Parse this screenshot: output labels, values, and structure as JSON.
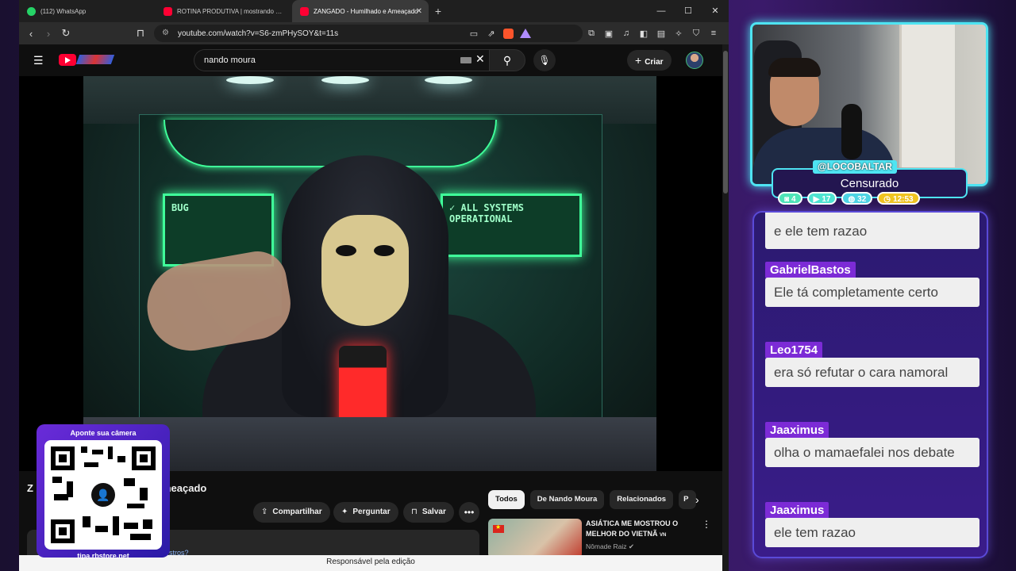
{
  "browser": {
    "tabs": [
      {
        "label": "(112) WhatsApp",
        "icon": "whatsapp-icon"
      },
      {
        "label": "ROTINA PRODUTIVA | mostrando meus hábitos",
        "icon": "youtube-icon"
      },
      {
        "label": "ZANGADO - Humilhado e Ameaçado",
        "icon": "youtube-icon",
        "active": true
      }
    ],
    "url": "youtube.com/watch?v=S6-zmPHySOY&t=11s",
    "status_bar": "Responsável pela edição"
  },
  "youtube": {
    "search_query": "nando moura",
    "create_label": "Criar",
    "video": {
      "title_prefix": "Z",
      "title_suffix": "meaçado",
      "screen_left": "BUG",
      "screen_right": "ALL SYSTEMS OPERATIONAL",
      "desc_link": "estros?"
    },
    "actions": {
      "share": "Compartilhar",
      "ask": "Perguntar",
      "save": "Salvar"
    },
    "chips": [
      "Todos",
      "De Nando Moura",
      "Relacionados",
      "P"
    ],
    "recommended": {
      "title": "ASIÁTICA ME MOSTROU O MELHOR DO VIETNÃ",
      "title_tag": "VN",
      "channel": "Nômade Raiz"
    }
  },
  "qr": {
    "title": "Aponte sua câmera",
    "footer": "tipa.rbstore.net"
  },
  "stream": {
    "handle": "@LOCOBALTAR",
    "status": "Censurado",
    "stats": {
      "twitch": "4",
      "youtube": "17",
      "kick": "32",
      "clock": "12:53"
    }
  },
  "chat": [
    {
      "user": "",
      "text": "e ele tem razao"
    },
    {
      "user": "GabrielBastos",
      "text": "Ele tá completamente certo"
    },
    {
      "user": "Leo1754",
      "text": "era só refutar o cara namoral"
    },
    {
      "user": "Jaaximus",
      "text": "olha o mamaefalei nos debate"
    },
    {
      "user": "Jaaximus",
      "text": "ele tem razao"
    }
  ],
  "colors": {
    "accent_cyan": "#4ee4f2",
    "chat_user_bg": "#7c2bd6",
    "youtube_red": "#ff0033",
    "clock_badge": "#f0c420"
  }
}
